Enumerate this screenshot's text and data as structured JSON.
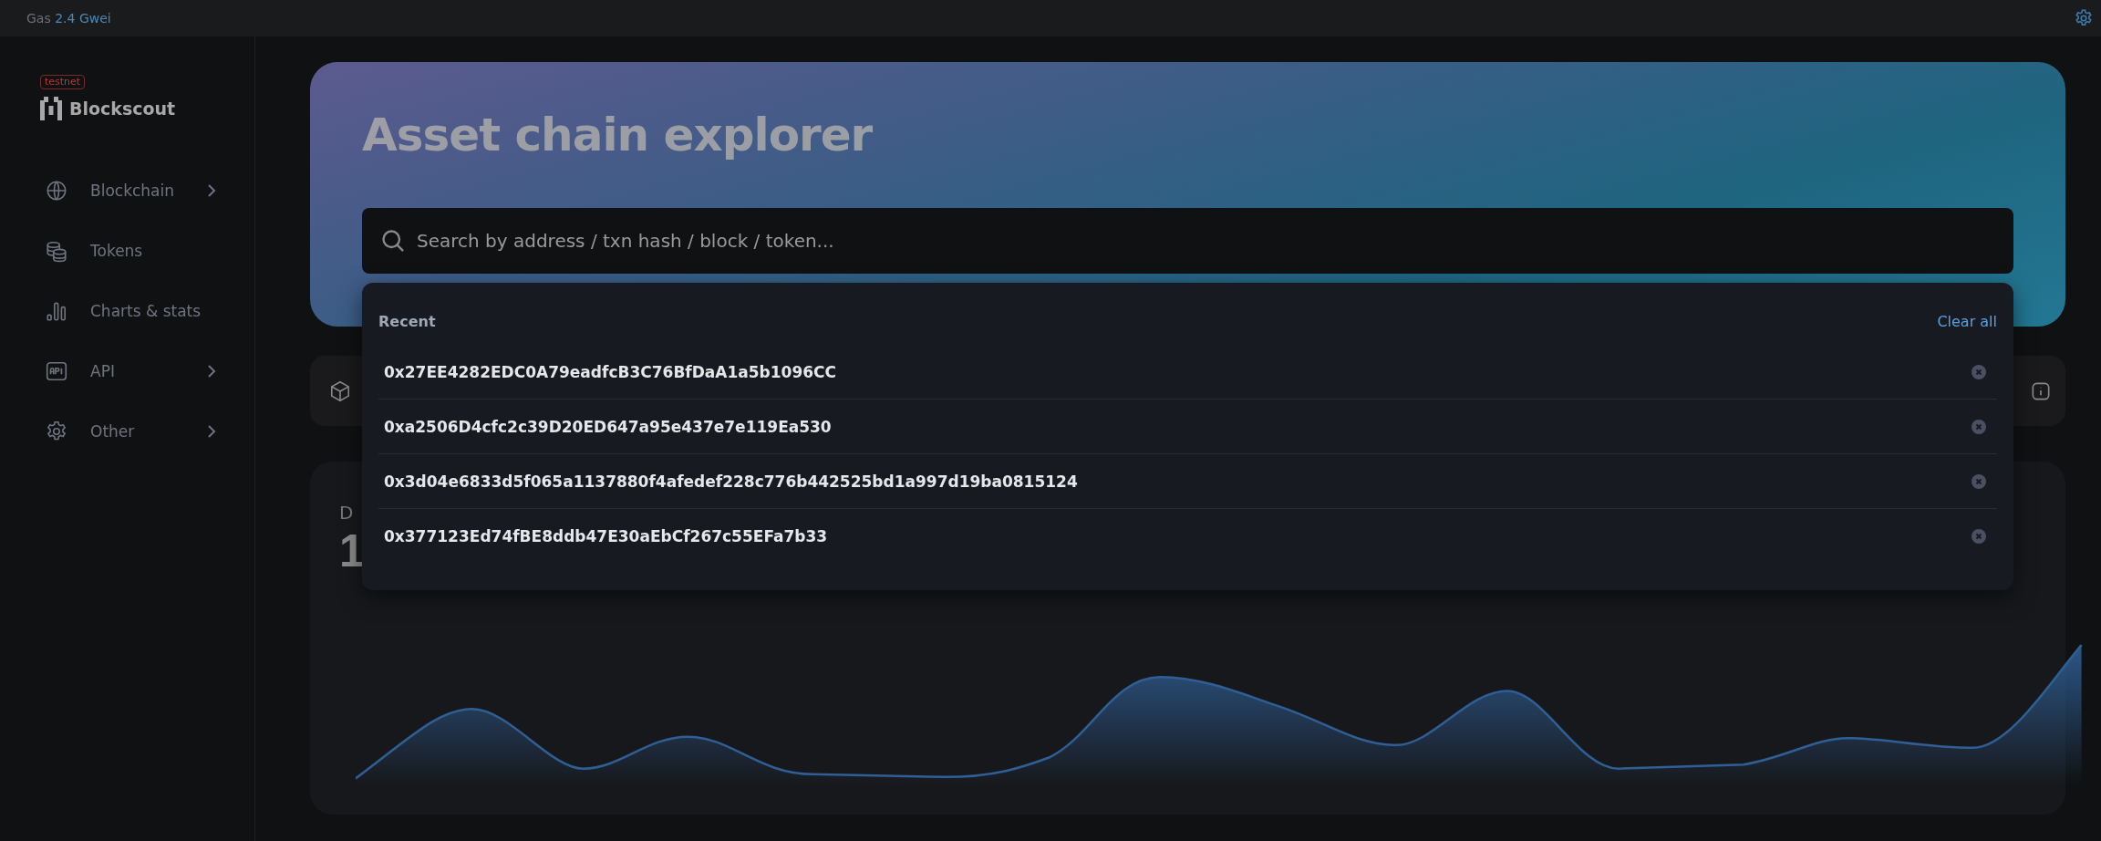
{
  "top_bar": {
    "gas_label": "Gas",
    "gas_value": "2.4 Gwei"
  },
  "sidebar": {
    "badge": "testnet",
    "logo_text": "Blockscout",
    "items": [
      {
        "label": "Blockchain",
        "has_submenu": true
      },
      {
        "label": "Tokens",
        "has_submenu": false
      },
      {
        "label": "Charts & stats",
        "has_submenu": false
      },
      {
        "label": "API",
        "has_submenu": true
      },
      {
        "label": "Other",
        "has_submenu": true
      }
    ]
  },
  "hero": {
    "title": "Asset chain explorer",
    "search": {
      "placeholder": "Search by address / txn hash / block / token..."
    }
  },
  "recent": {
    "heading": "Recent",
    "clear_label": "Clear all",
    "items": [
      "0x27EE4282EDC0A79eadfcB3C76BfDaA1a5b1096CC",
      "0xa2506D4cfc2c39D20ED647a95e437e7e119Ea530",
      "0x3d04e6833d5f065a1137880f4afedef228c776b442525bd1a997d19ba0815124",
      "0x377123Ed74fBE8ddb47E30aEbCf267c55EFa7b33"
    ]
  },
  "stat_card": {
    "title": "D",
    "value": "1"
  }
}
